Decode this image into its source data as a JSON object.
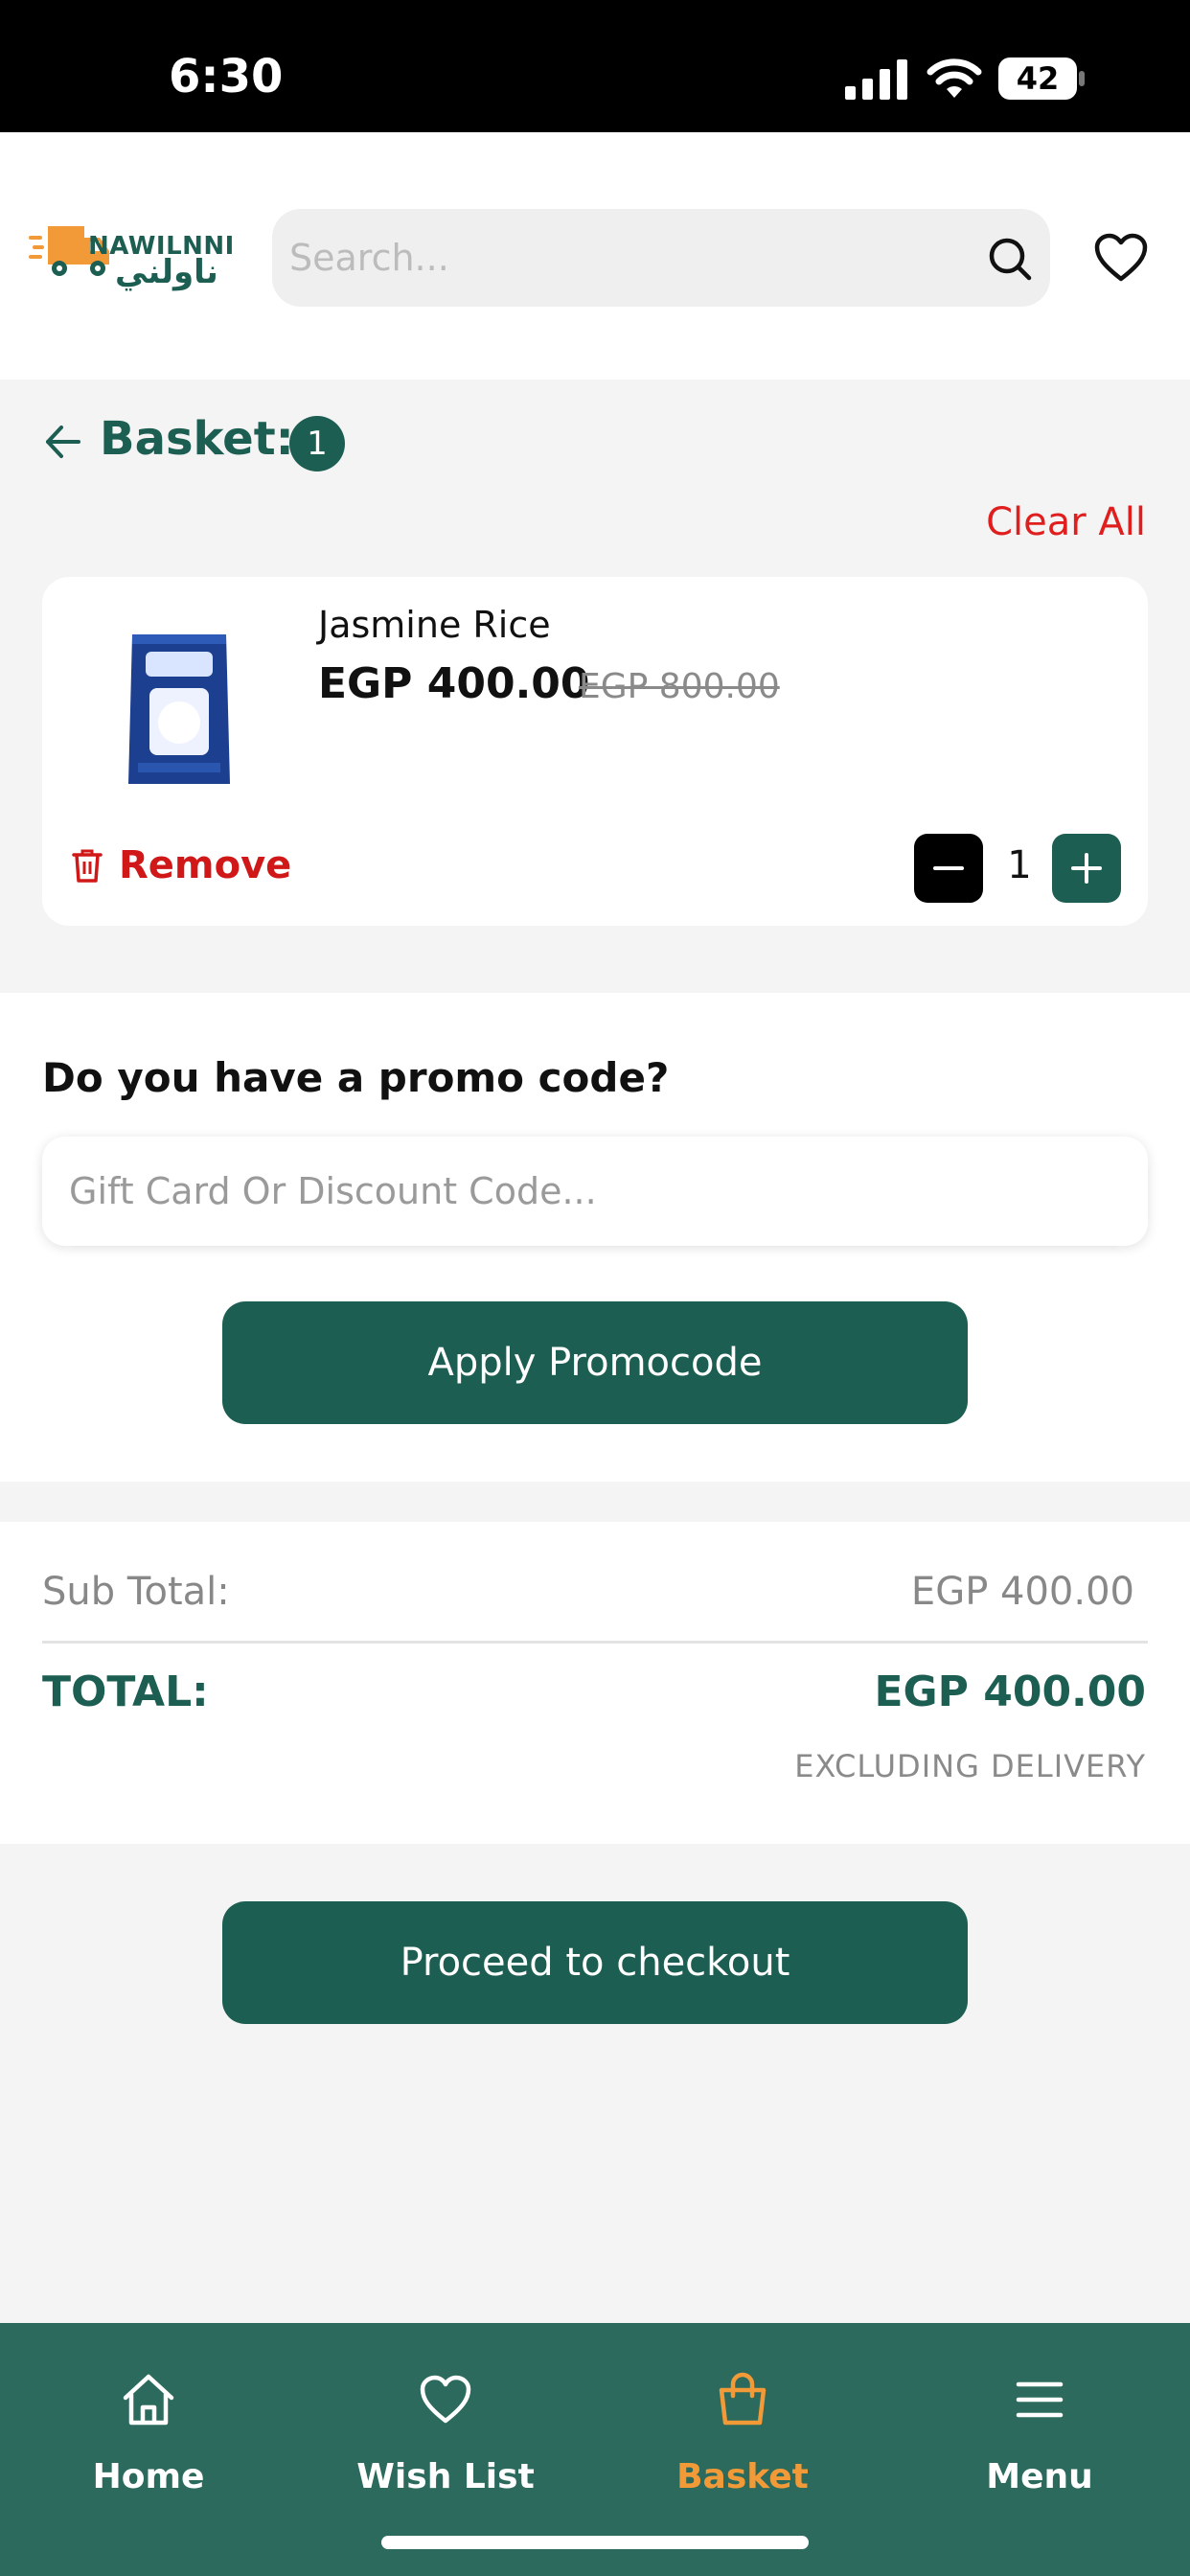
{
  "status_bar": {
    "time": "6:30",
    "battery": "42"
  },
  "header": {
    "logo_en": "NAWILNNI",
    "logo_ar": "ناولني",
    "search_placeholder": "Search..."
  },
  "basket": {
    "title": "Basket:",
    "count": "1",
    "clear_all": "Clear All"
  },
  "items": [
    {
      "name": "Jasmine Rice",
      "price": "EGP 400.00",
      "old_price": "EGP 800.00",
      "remove_label": "Remove",
      "quantity": "1"
    }
  ],
  "promo": {
    "question": "Do you have a promo code?",
    "placeholder": "Gift Card Or Discount Code...",
    "apply_label": "Apply Promocode"
  },
  "totals": {
    "sub_total_label": "Sub Total:",
    "sub_total_value": "EGP 400.00",
    "total_label": "TOTAL:",
    "total_value": "EGP 400.00",
    "note": "EXCLUDING DELIVERY"
  },
  "checkout_label": "Proceed to checkout",
  "bottom_nav": [
    {
      "label": "Home",
      "icon": "home-icon"
    },
    {
      "label": "Wish List",
      "icon": "heart-icon"
    },
    {
      "label": "Basket",
      "icon": "basket-icon",
      "active": true
    },
    {
      "label": "Menu",
      "icon": "menu-icon"
    }
  ],
  "colors": {
    "brand": "#1d5e52",
    "nav_bg": "#2b6a5d",
    "active_nav": "#f29a38",
    "danger": "#e01e1e"
  }
}
